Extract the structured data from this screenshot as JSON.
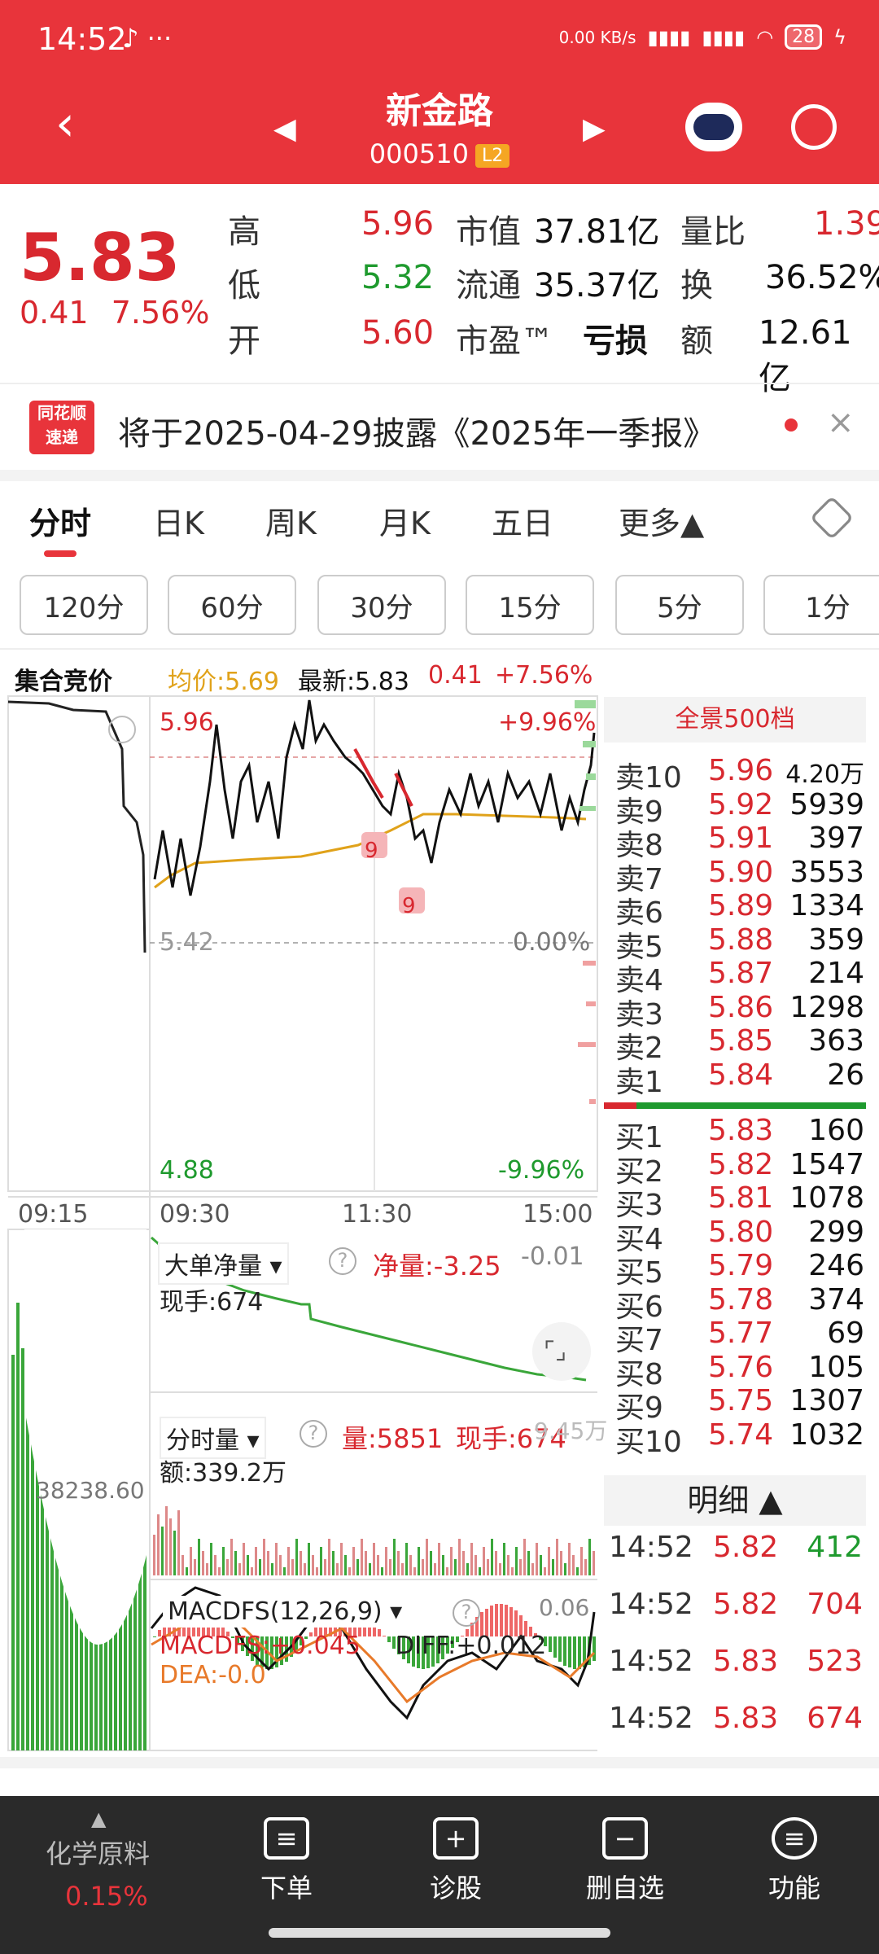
{
  "status": {
    "time": "14:52",
    "net": "0.00 KB/s",
    "battery": "28"
  },
  "header": {
    "name": "新金路",
    "code": "000510",
    "level": "L2"
  },
  "quote": {
    "price": "5.83",
    "change": "0.41",
    "change_pct": "7.56%",
    "high_label": "高",
    "high": "5.96",
    "low_label": "低",
    "low": "5.32",
    "open_label": "开",
    "open": "5.60",
    "mktcap_label": "市值",
    "mktcap": "37.81亿",
    "float_label": "流通",
    "float": "35.37亿",
    "pe_label": "市盈™",
    "pe": "亏损",
    "vol_ratio_label": "量比",
    "vol_ratio": "1.39",
    "turnover_label": "换",
    "turnover": "36.52%",
    "amount_label": "额",
    "amount": "12.61亿"
  },
  "notice": {
    "icon_top": "同花顺",
    "icon_bottom": "速递",
    "text": "将于2025-04-29披露《2025年一季报》"
  },
  "tabs": [
    "分时",
    "日K",
    "周K",
    "月K",
    "五日",
    "更多▲"
  ],
  "periods": [
    "120分",
    "60分",
    "30分",
    "15分",
    "5分",
    "1分"
  ],
  "chart_header": {
    "auction": "集合竞价",
    "avg": "均价:5.69",
    "latest": "最新:5.83",
    "chg": "0.41",
    "pct": "+7.56%"
  },
  "chart_labels": {
    "top": "5.96",
    "top_pct": "+9.96%",
    "mid": "5.42",
    "mid_pct": "0.00%",
    "bottom": "4.88",
    "bottom_pct": "-9.96%",
    "t0": "09:15",
    "t1": "09:30",
    "t2": "11:30",
    "t3": "15:00",
    "marker": "9",
    "left_val": "38238.60"
  },
  "big_order": {
    "name": "大单净量",
    "net": "净量:-3.25",
    "side": "-0.01",
    "hand": "现手:674"
  },
  "volume": {
    "name": "分时量",
    "vol": "量:5851",
    "hand": "现手:674",
    "amt": "额:339.2万",
    "side": "9.45万"
  },
  "macd": {
    "name": "MACDFS(12,26,9)",
    "macd": "MACDFS:+0.045",
    "diff": "DIFF:+0.012",
    "dea": "DEA:-0.0",
    "side": "0.06"
  },
  "order_book": {
    "title": "全景500档",
    "asks": [
      {
        "label": "卖10",
        "price": "5.96",
        "vol": "4.20万"
      },
      {
        "label": "卖9",
        "price": "5.92",
        "vol": "5939"
      },
      {
        "label": "卖8",
        "price": "5.91",
        "vol": "397"
      },
      {
        "label": "卖7",
        "price": "5.90",
        "vol": "3553"
      },
      {
        "label": "卖6",
        "price": "5.89",
        "vol": "1334"
      },
      {
        "label": "卖5",
        "price": "5.88",
        "vol": "359"
      },
      {
        "label": "卖4",
        "price": "5.87",
        "vol": "214"
      },
      {
        "label": "卖3",
        "price": "5.86",
        "vol": "1298"
      },
      {
        "label": "卖2",
        "price": "5.85",
        "vol": "363"
      },
      {
        "label": "卖1",
        "price": "5.84",
        "vol": "26"
      }
    ],
    "bids": [
      {
        "label": "买1",
        "price": "5.83",
        "vol": "160"
      },
      {
        "label": "买2",
        "price": "5.82",
        "vol": "1547"
      },
      {
        "label": "买3",
        "price": "5.81",
        "vol": "1078"
      },
      {
        "label": "买4",
        "price": "5.80",
        "vol": "299"
      },
      {
        "label": "买5",
        "price": "5.79",
        "vol": "246"
      },
      {
        "label": "买6",
        "price": "5.78",
        "vol": "374"
      },
      {
        "label": "买7",
        "price": "5.77",
        "vol": "69"
      },
      {
        "label": "买8",
        "price": "5.76",
        "vol": "105"
      },
      {
        "label": "买9",
        "price": "5.75",
        "vol": "1307"
      },
      {
        "label": "买10",
        "price": "5.74",
        "vol": "1032"
      }
    ]
  },
  "detail": {
    "title": "明细 ▲",
    "rows": [
      {
        "time": "14:52",
        "price": "5.82",
        "vol": "412",
        "dir": "down"
      },
      {
        "time": "14:52",
        "price": "5.82",
        "vol": "704",
        "dir": "up"
      },
      {
        "time": "14:52",
        "price": "5.83",
        "vol": "523",
        "dir": "up"
      },
      {
        "time": "14:52",
        "price": "5.83",
        "vol": "674",
        "dir": "up"
      }
    ]
  },
  "bottom_nav": {
    "sector": "化学原料",
    "sector_pct": "0.15%",
    "items": [
      "下单",
      "诊股",
      "删自选",
      "功能"
    ]
  },
  "colors": {
    "up": "#d8282f",
    "down": "#1f9a2e",
    "header": "#e8343b",
    "avg_line": "#e0a21a"
  }
}
